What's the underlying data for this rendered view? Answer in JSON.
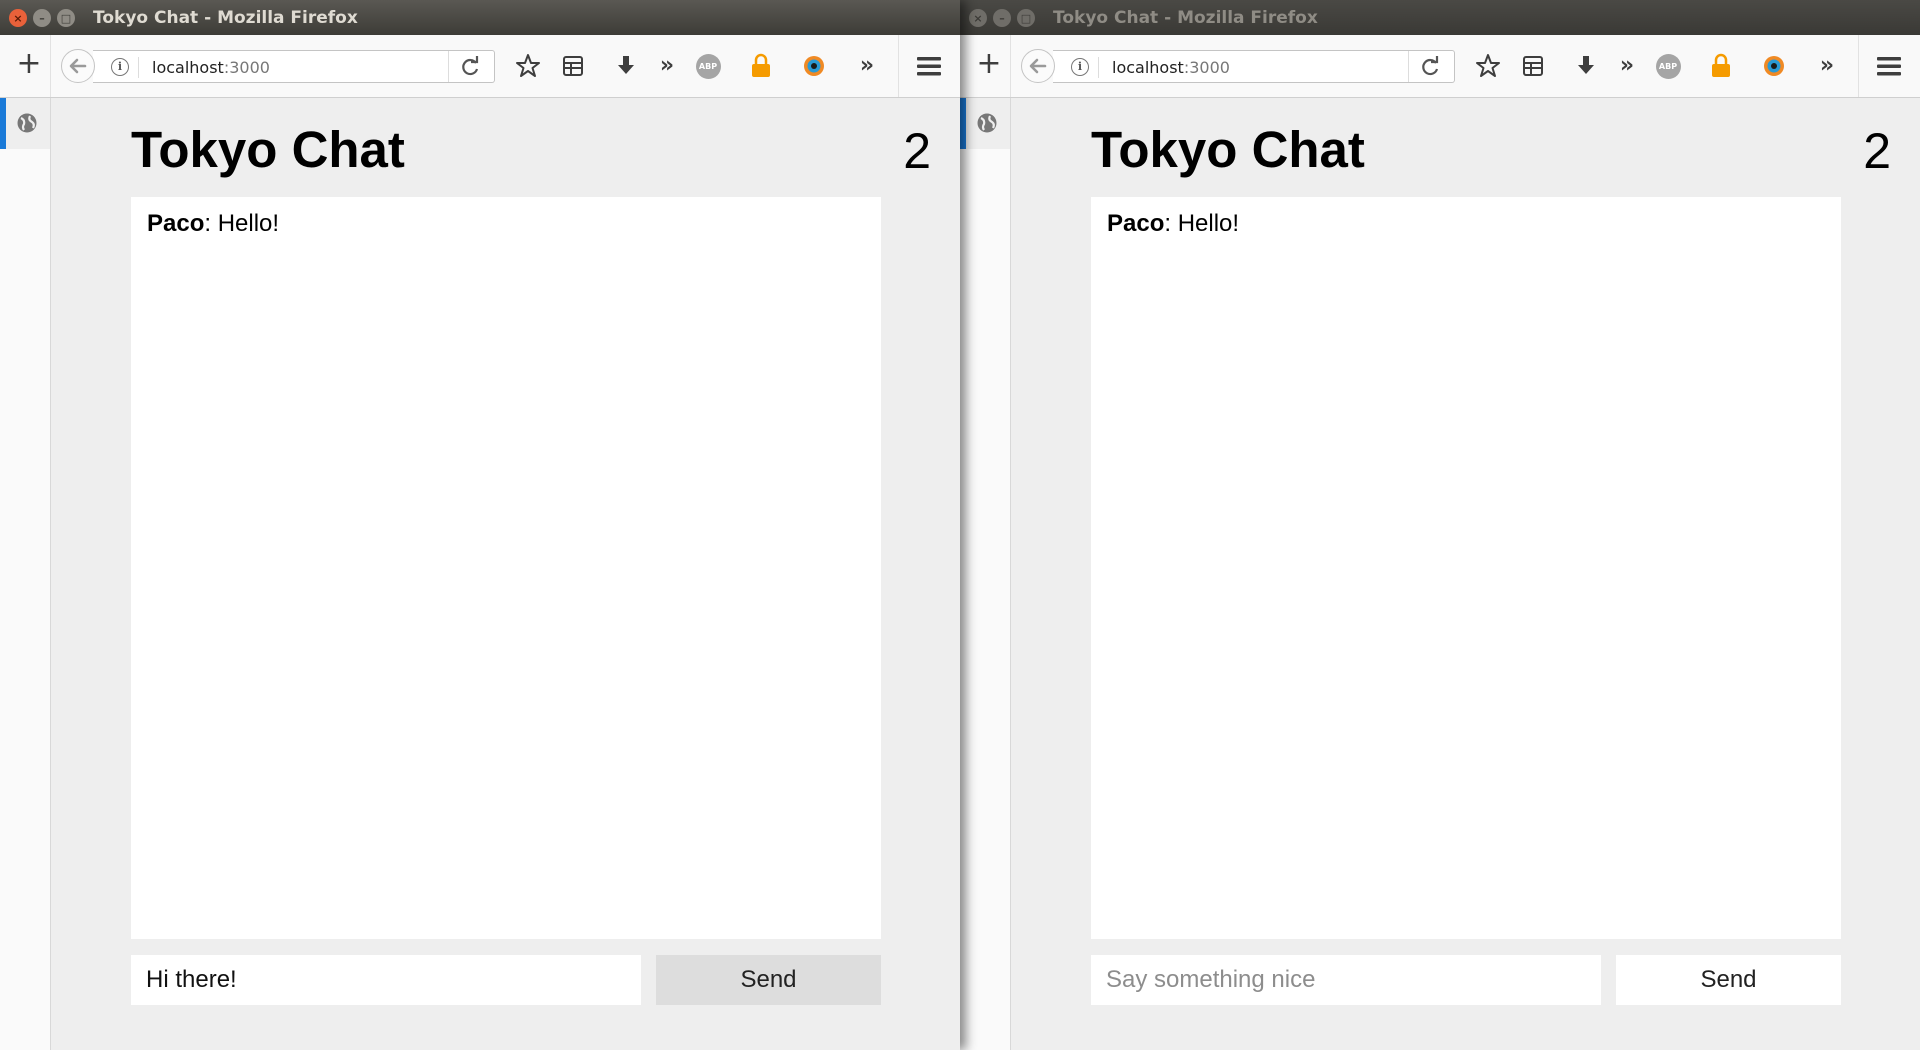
{
  "windows": [
    {
      "title": "Tokyo Chat - Mozilla Firefox",
      "url_host": "localhost",
      "url_port": ":3000",
      "app": {
        "title": "Tokyo Chat",
        "user_count": "2",
        "messages": [
          {
            "author": "Paco",
            "separator": ":",
            "text": " Hello!"
          }
        ],
        "input_value": "Hi there!",
        "input_placeholder": "Say something nice",
        "send_label": "Send"
      }
    },
    {
      "title": "Tokyo Chat - Mozilla Firefox",
      "url_host": "localhost",
      "url_port": ":3000",
      "app": {
        "title": "Tokyo Chat",
        "user_count": "2",
        "messages": [
          {
            "author": "Paco",
            "separator": ":",
            "text": " Hello!"
          }
        ],
        "input_value": "",
        "input_placeholder": "Say something nice",
        "send_label": "Send"
      }
    }
  ],
  "toolbar": {
    "abp_label": "ABP",
    "overflow_glyph": "»",
    "more_glyph": "»",
    "new_tab_glyph": "+"
  },
  "colors": {
    "sidebar_accent": "#1a7ad8",
    "lock_icon": "#f59b00",
    "close_button": "#e9613a",
    "send_pressed_bg": "#dddddd"
  }
}
